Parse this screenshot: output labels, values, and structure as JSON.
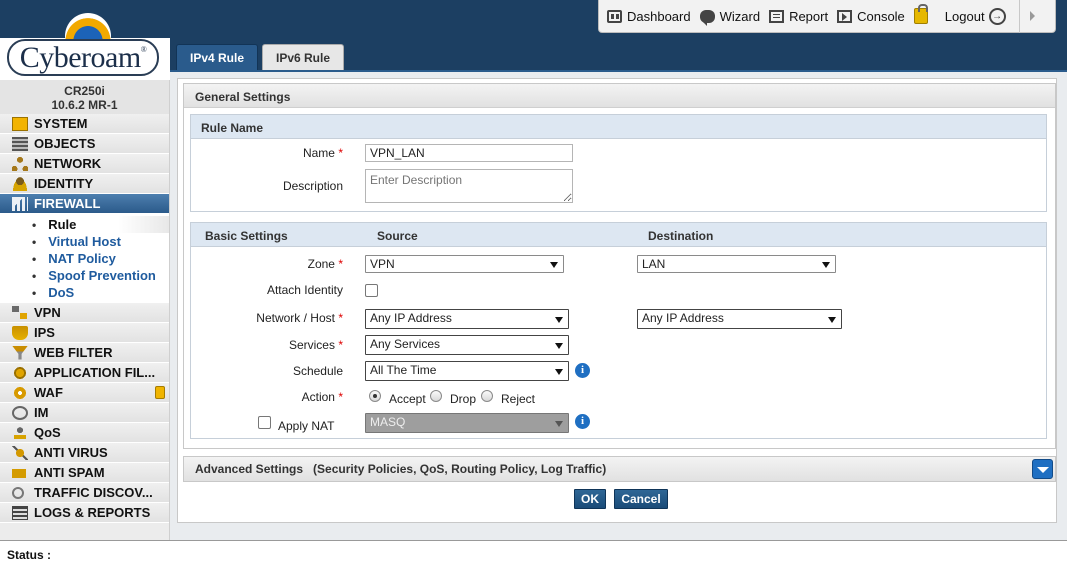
{
  "topnav": {
    "dashboard": "Dashboard",
    "wizard": "Wizard",
    "report": "Report",
    "console": "Console",
    "logout": "Logout"
  },
  "logo": {
    "text": "Cyberoam",
    "mark": "®"
  },
  "device": {
    "model": "CR250i",
    "version": "10.6.2 MR-1"
  },
  "sidebar": {
    "items": [
      {
        "label": "SYSTEM",
        "icon": "system-icon"
      },
      {
        "label": "OBJECTS",
        "icon": "objects-icon"
      },
      {
        "label": "NETWORK",
        "icon": "network-icon"
      },
      {
        "label": "IDENTITY",
        "icon": "identity-icon"
      },
      {
        "label": "FIREWALL",
        "icon": "firewall-icon",
        "active": true
      },
      {
        "label": "VPN",
        "icon": "vpn-icon"
      },
      {
        "label": "IPS",
        "icon": "ips-icon"
      },
      {
        "label": "WEB FILTER",
        "icon": "web-filter-icon"
      },
      {
        "label": "APPLICATION FIL...",
        "icon": "application-filter-icon"
      },
      {
        "label": "WAF",
        "icon": "waf-icon"
      },
      {
        "label": "IM",
        "icon": "im-icon"
      },
      {
        "label": "QoS",
        "icon": "qos-icon"
      },
      {
        "label": "ANTI VIRUS",
        "icon": "anti-virus-icon"
      },
      {
        "label": "ANTI SPAM",
        "icon": "anti-spam-icon"
      },
      {
        "label": "TRAFFIC DISCOV...",
        "icon": "traffic-discovery-icon"
      },
      {
        "label": "LOGS & REPORTS",
        "icon": "logs-reports-icon"
      }
    ],
    "firewall_sub": [
      "Rule",
      "Virtual Host",
      "NAT Policy",
      "Spoof Prevention",
      "DoS"
    ]
  },
  "tabs": {
    "ipv4": "IPv4 Rule",
    "ipv6": "IPv6 Rule"
  },
  "general": {
    "title": "General Settings",
    "rule_name": {
      "title": "Rule Name",
      "name_label": "Name",
      "name_value": "VPN_LAN",
      "desc_label": "Description",
      "desc_placeholder": "Enter Description"
    },
    "basic": {
      "title": "Basic Settings",
      "source_hdr": "Source",
      "dest_hdr": "Destination",
      "zone_label": "Zone",
      "zone_source": "VPN",
      "zone_dest": "LAN",
      "attach_identity_label": "Attach Identity",
      "network_label": "Network / Host",
      "network_source": "Any IP Address",
      "network_dest": "Any IP Address",
      "services_label": "Services",
      "services_value": "Any Services",
      "schedule_label": "Schedule",
      "schedule_value": "All The Time",
      "action_label": "Action",
      "action_accept": "Accept",
      "action_drop": "Drop",
      "action_reject": "Reject",
      "apply_nat_label": "Apply NAT",
      "nat_value": "MASQ"
    }
  },
  "advanced": {
    "title": "Advanced Settings",
    "hint": "(Security Policies, QoS, Routing Policy, Log Traffic)"
  },
  "buttons": {
    "ok": "OK",
    "cancel": "Cancel"
  },
  "status": {
    "label": "Status :"
  },
  "colors": {
    "header": "#1c3f62",
    "accent": "#2a5b8c",
    "required": "#dd0000",
    "link": "#1f5b9e"
  }
}
